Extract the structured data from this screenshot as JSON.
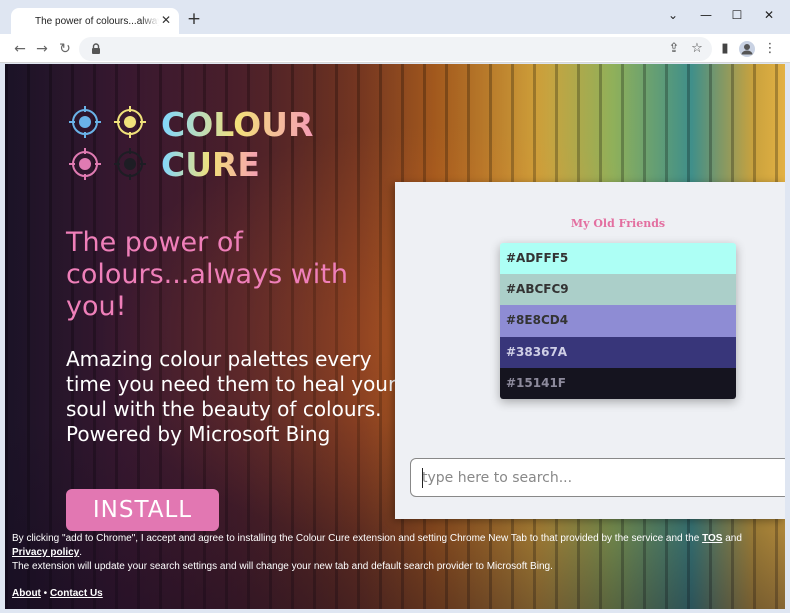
{
  "browser": {
    "tab_title": "The power of colours...always with you!",
    "tab_close": "✕",
    "new_tab": "+",
    "window_controls": {
      "minimize": "⌄",
      "restore": "—",
      "maximize": "☐",
      "close": "✕"
    }
  },
  "page": {
    "logo": {
      "line1": "COLOUR",
      "line2": "CURE"
    },
    "headline": "The power of colours...always with you!",
    "subtext": "Amazing colour palettes every time you need them to heal your soul with the beauty of colours. Powered by Microsoft Bing",
    "install_label": "INSTALL",
    "preview": {
      "title": "My Old Friends",
      "swatches": [
        {
          "hex": "#ADFFF5",
          "color": "#ADFFF5",
          "text_color": "#333333"
        },
        {
          "hex": "#ABCFC9",
          "color": "#ABCFC9",
          "text_color": "#333333"
        },
        {
          "hex": "#8E8CD4",
          "color": "#8E8CD4",
          "text_color": "#333333"
        },
        {
          "hex": "#38367A",
          "color": "#38367A",
          "text_color": "#cfcfe6"
        },
        {
          "hex": "#15141F",
          "color": "#15141F",
          "text_color": "#8d8a9c"
        }
      ],
      "search_placeholder": "type here to search..."
    },
    "disclaimer": {
      "text_before": "By clicking \"add to Chrome\", I accept and agree to installing the Colour Cure extension and setting Chrome New Tab to that provided by the service and the ",
      "tos_link": "TOS",
      "and": " and ",
      "privacy_link": "Privacy policy",
      "period": ".",
      "line2": "The extension will update your search settings and will change your new tab and default search provider to Microsoft Bing."
    },
    "footer": {
      "about": "About",
      "separator": " • ",
      "contact": "Contact Us"
    }
  },
  "colors": {
    "accent_pink": "#E277B2",
    "headline_pink": "#EF7FB9",
    "chrome_bg": "#DFE6F2"
  }
}
